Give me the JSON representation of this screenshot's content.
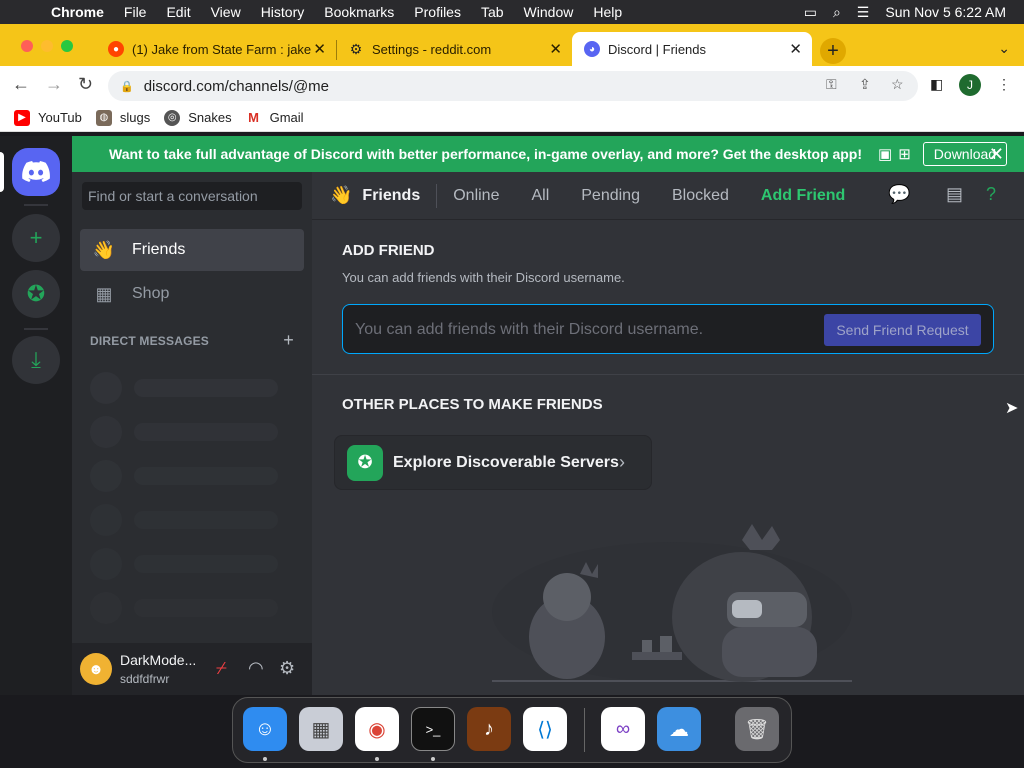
{
  "menubar": {
    "app": "Chrome",
    "items": [
      "File",
      "Edit",
      "View",
      "History",
      "Bookmarks",
      "Profiles",
      "Tab",
      "Window",
      "Help"
    ],
    "clock": "Sun Nov 5  6:22 AM"
  },
  "tabs": [
    {
      "title": "(1) Jake from State Farm : jake",
      "icon": "reddit-icon"
    },
    {
      "title": "Settings - reddit.com",
      "icon": "gear-icon"
    },
    {
      "title": "Discord | Friends",
      "icon": "discord-icon",
      "active": true
    }
  ],
  "address": {
    "url": "discord.com/channels/@me"
  },
  "profile_initial": "J",
  "bookmarks": [
    {
      "label": "YouTub",
      "icon": "youtube-icon"
    },
    {
      "label": "slugs",
      "icon": "slug-icon"
    },
    {
      "label": "Snakes",
      "icon": "globe-icon"
    },
    {
      "label": "Gmail",
      "icon": "gmail-icon"
    }
  ],
  "banner": {
    "text": "Want to take full advantage of Discord with better performance, in-game overlay, and more? Get the desktop app!",
    "download_label": "Download"
  },
  "sidebar": {
    "search_placeholder": "Find or start a conversation",
    "items": [
      {
        "label": "Friends",
        "icon": "friends-icon",
        "selected": true
      },
      {
        "label": "Shop",
        "icon": "shop-icon"
      }
    ],
    "dm_header": "DIRECT MESSAGES"
  },
  "user": {
    "name": "DarkMode...",
    "tag": "sddfdfrwr"
  },
  "topbar": {
    "title": "Friends",
    "tabs": [
      "Online",
      "All",
      "Pending",
      "Blocked"
    ],
    "add_friend": "Add Friend"
  },
  "add_friend": {
    "heading": "ADD FRIEND",
    "subtitle": "You can add friends with their Discord username.",
    "placeholder": "You can add friends with their Discord username.",
    "button": "Send Friend Request"
  },
  "other_places": {
    "heading": "OTHER PLACES TO MAKE FRIENDS",
    "explore_label": "Explore Discoverable Servers"
  },
  "colors": {
    "blurple": "#5865f2",
    "green": "#23a55a",
    "chrome_frame": "#f5c518",
    "input_focus": "#00a8fc"
  },
  "dock": [
    "finder-icon",
    "launchpad-icon",
    "chrome-icon",
    "terminal-icon",
    "garageband-icon",
    "vscode-icon",
    "visual-studio-icon",
    "weather-icon",
    "trash-icon"
  ]
}
